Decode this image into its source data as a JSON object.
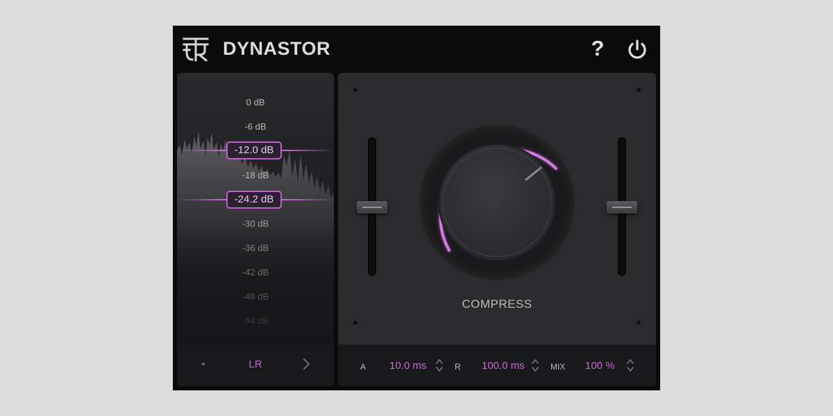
{
  "header": {
    "title": "DYNASTOR",
    "help_label": "?"
  },
  "meter": {
    "scale": [
      "0 dB",
      "-6 dB",
      "-12 dB",
      "-18 dB",
      "-24 dB",
      "-30 dB",
      "-36 dB",
      "-42 dB",
      "-48 dB",
      "-54 dB"
    ],
    "upper_threshold": "-12.0 dB",
    "lower_threshold": "-24.2 dB",
    "channel": "LR"
  },
  "compressor": {
    "knob_label": "COMPRESS",
    "attack_key": "A",
    "attack_value": "10.0 ms",
    "release_key": "R",
    "release_value": "100.0 ms",
    "mix_key": "MIX",
    "mix_value": "100 %"
  },
  "colors": {
    "accent": "#c76ad6",
    "panel": "#2b2b2d",
    "background": "#0b0b0c"
  },
  "icons": {
    "logo": "brand-logo-icon",
    "power": "power-icon",
    "channel_next": "chevron-right-icon",
    "stepper": "up-down-stepper-icon"
  }
}
